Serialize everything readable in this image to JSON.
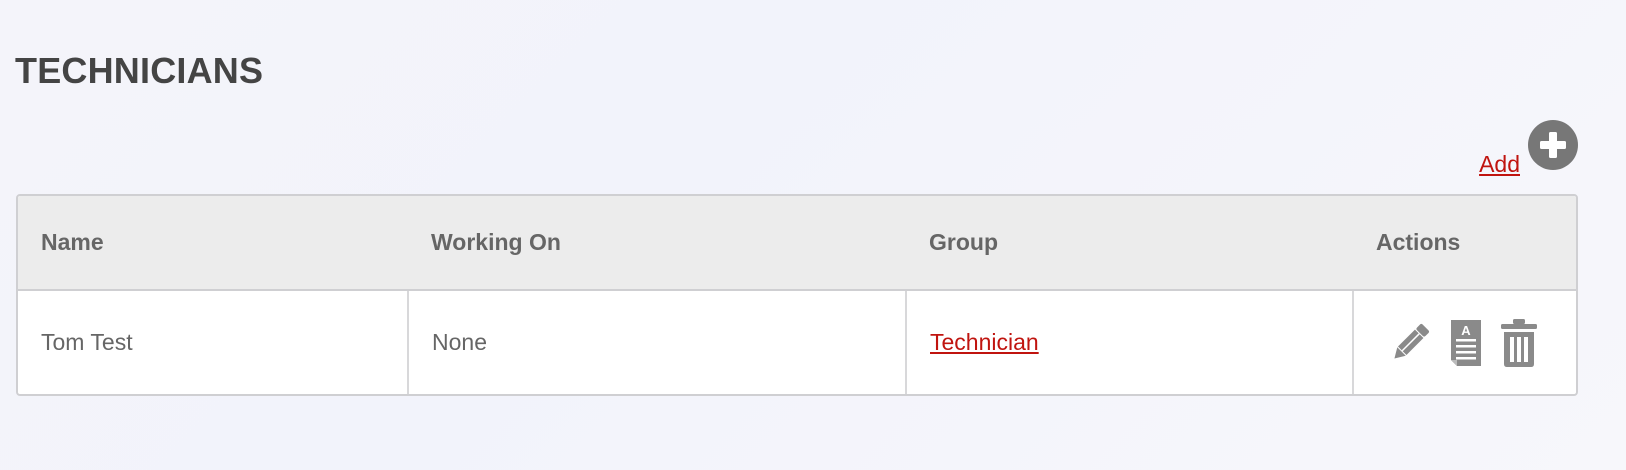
{
  "page": {
    "title": "TECHNICIANS"
  },
  "toolbar": {
    "add_label": "Add",
    "add_icon": "plus-circle-icon"
  },
  "table": {
    "columns": [
      "Name",
      "Working On",
      "Group",
      "Actions"
    ],
    "rows": [
      {
        "name": "Tom Test",
        "working_on": "None",
        "group": "Technician",
        "actions": [
          "pencil-icon",
          "document-icon",
          "trash-icon"
        ]
      }
    ]
  },
  "colors": {
    "link": "#c0140f",
    "icon_gray": "#777777",
    "header_bg": "#ececec"
  }
}
